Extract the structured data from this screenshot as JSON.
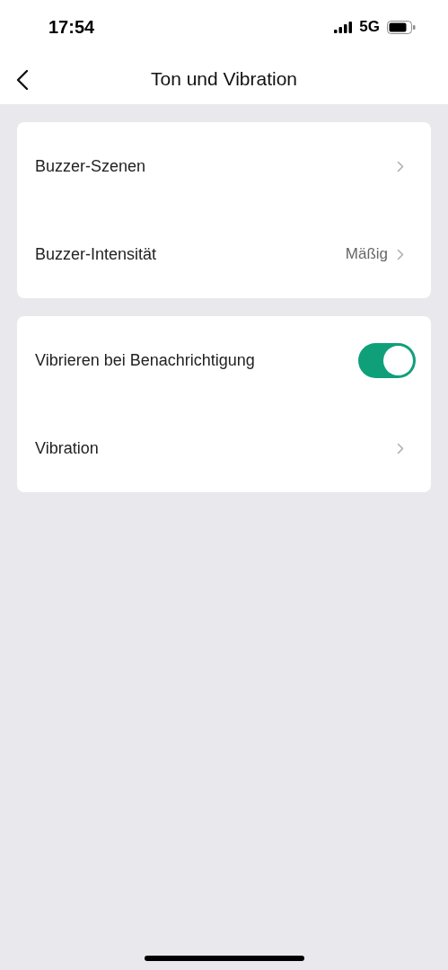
{
  "status_bar": {
    "time": "17:54",
    "network": "5G"
  },
  "header": {
    "title": "Ton und Vibration"
  },
  "groups": [
    {
      "rows": [
        {
          "kind": "link",
          "label": "Buzzer-Szenen"
        },
        {
          "kind": "link",
          "label": "Buzzer-Intensität",
          "value": "Mäßig"
        }
      ]
    },
    {
      "rows": [
        {
          "kind": "toggle",
          "label": "Vibrieren bei Benachrichtigung",
          "on": true
        },
        {
          "kind": "link",
          "label": "Vibration"
        }
      ]
    }
  ]
}
